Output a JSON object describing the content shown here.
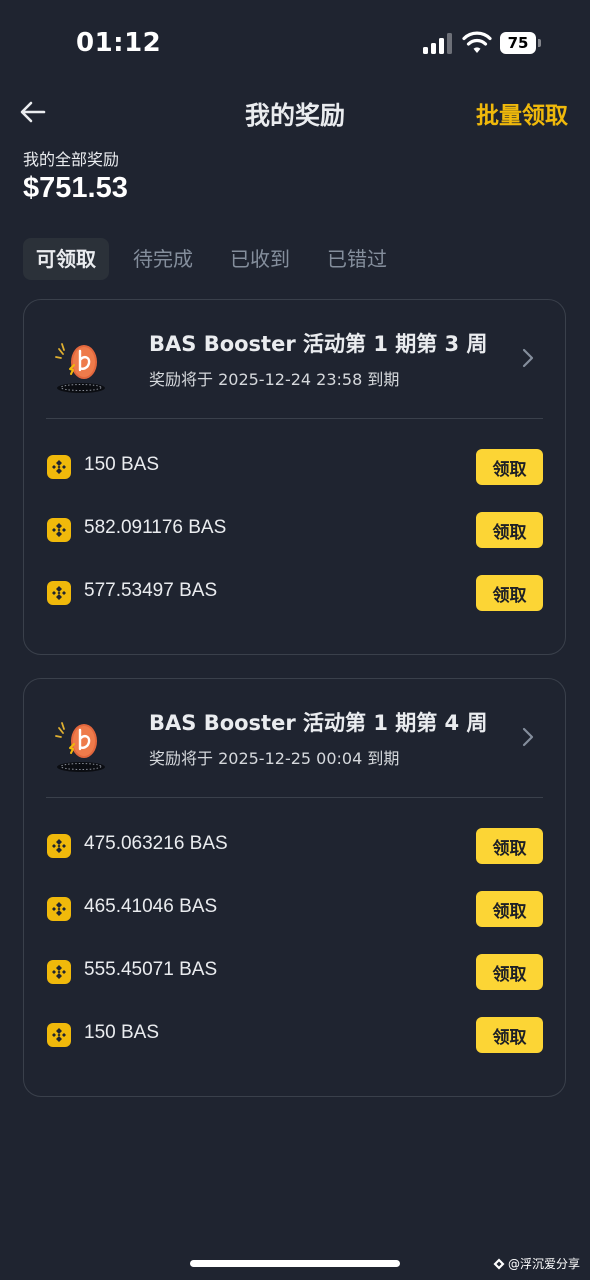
{
  "status_bar": {
    "time": "01:12",
    "battery": "75"
  },
  "header": {
    "title": "我的奖励",
    "bulk_claim": "批量领取"
  },
  "summary": {
    "label": "我的全部奖励",
    "amount": "$751.53"
  },
  "tabs": [
    {
      "label": "可领取",
      "active": true
    },
    {
      "label": "待完成",
      "active": false
    },
    {
      "label": "已收到",
      "active": false
    },
    {
      "label": "已错过",
      "active": false
    }
  ],
  "cards": [
    {
      "title": "BAS Booster 活动第 1 期第 3 周",
      "expiry": "奖励将于 2025-12-24 23:58 到期",
      "rewards": [
        {
          "amount": "150 BAS",
          "button": "领取"
        },
        {
          "amount": "582.091176 BAS",
          "button": "领取"
        },
        {
          "amount": "577.53497 BAS",
          "button": "领取"
        }
      ]
    },
    {
      "title": "BAS Booster 活动第 1 期第 4 周",
      "expiry": "奖励将于 2025-12-25 00:04 到期",
      "rewards": [
        {
          "amount": "475.063216 BAS",
          "button": "领取"
        },
        {
          "amount": "465.41046 BAS",
          "button": "领取"
        },
        {
          "amount": "555.45071 BAS",
          "button": "领取"
        },
        {
          "amount": "150 BAS",
          "button": "领取"
        }
      ]
    }
  ],
  "watermark": "@浮沉爱分享",
  "colors": {
    "background": "#1F2430",
    "accent": "#F0B90B",
    "claim_button": "#FCD535",
    "tab_active_bg": "#2B3139",
    "muted_text": "#848E9C"
  },
  "icons": {
    "back": "arrow-left-icon",
    "chevron": "chevron-right-icon",
    "coin": "bnb-coin-icon",
    "logo": "bas-booster-logo"
  }
}
